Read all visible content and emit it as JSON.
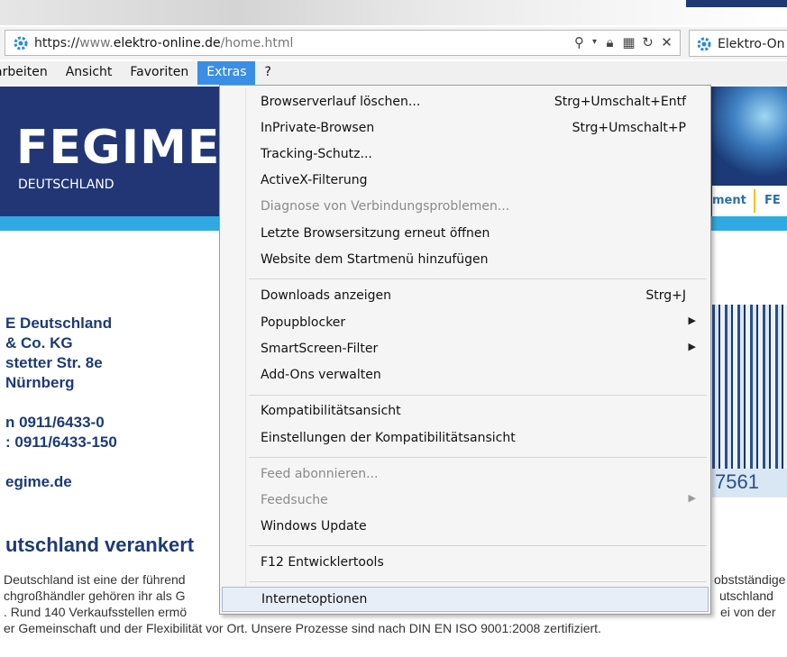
{
  "address_bar": {
    "url_protocol": "https://",
    "url_www": "www.",
    "url_domain": "elektro-online.de",
    "url_path": "/home.html"
  },
  "tab": {
    "title": "Elektro-On"
  },
  "menubar": {
    "items": [
      "arbeiten",
      "Ansicht",
      "Favoriten",
      "Extras",
      "?"
    ],
    "active": "Extras"
  },
  "page": {
    "logo": "FEGIME",
    "logo_sub": "DEUTSCHLAND",
    "nav_partial": [
      "ment",
      "FE"
    ],
    "address_lines": [
      "E Deutschland",
      "& Co. KG",
      "stetter Str. 8e",
      "Nürnberg",
      "n 0911/6433-0",
      ": 0911/6433-150",
      "egime.de"
    ],
    "barcode_number": "7561",
    "heading": "utschland verankert",
    "para_lines": [
      {
        "left": " Deutschland ist eine der führend",
        "right": "obstständige"
      },
      {
        "left": "chgroßhändler gehören ihr als G",
        "right": "utschland"
      },
      {
        "left": ". Rund 140 Verkaufsstellen ermö",
        "right": "ei von der"
      },
      {
        "left": "er Gemeinschaft und der Flexibilität vor Ort. Unsere Prozesse sind nach DIN EN ISO 9001:2008 zertifiziert.",
        "right": ""
      }
    ]
  },
  "dropdown": {
    "groups": [
      [
        {
          "label": "Browserverlauf löschen...",
          "shortcut": "Strg+Umschalt+Entf"
        },
        {
          "label": "InPrivate-Browsen",
          "shortcut": "Strg+Umschalt+P"
        },
        {
          "label": "Tracking-Schutz...",
          "shortcut": ""
        },
        {
          "label": "ActiveX-Filterung",
          "shortcut": ""
        },
        {
          "label": "Diagnose von Verbindungsproblemen...",
          "shortcut": "",
          "disabled": true
        },
        {
          "label": "Letzte Browsersitzung erneut öffnen",
          "shortcut": ""
        },
        {
          "label": "Website dem Startmenü hinzufügen",
          "shortcut": ""
        }
      ],
      [
        {
          "label": "Downloads anzeigen",
          "shortcut": "Strg+J"
        },
        {
          "label": "Popupblocker",
          "submenu": true
        },
        {
          "label": "SmartScreen-Filter",
          "submenu": true
        },
        {
          "label": "Add-Ons verwalten",
          "shortcut": ""
        }
      ],
      [
        {
          "label": "Kompatibilitätsansicht",
          "shortcut": ""
        },
        {
          "label": "Einstellungen der Kompatibilitätsansicht",
          "shortcut": ""
        }
      ],
      [
        {
          "label": "Feed abonnieren...",
          "shortcut": "",
          "disabled": true
        },
        {
          "label": "Feedsuche",
          "submenu": true,
          "disabled": true
        },
        {
          "label": "Windows Update",
          "shortcut": ""
        }
      ],
      [
        {
          "label": "F12 Entwicklertools",
          "shortcut": ""
        }
      ],
      [
        {
          "label": "Internetoptionen",
          "shortcut": "",
          "highlighted": true
        }
      ]
    ]
  },
  "colors": {
    "accent": "#3a8ee6",
    "banner": "#223676",
    "banner_strip": "#2fa9e1",
    "heading": "#1d3a79"
  }
}
